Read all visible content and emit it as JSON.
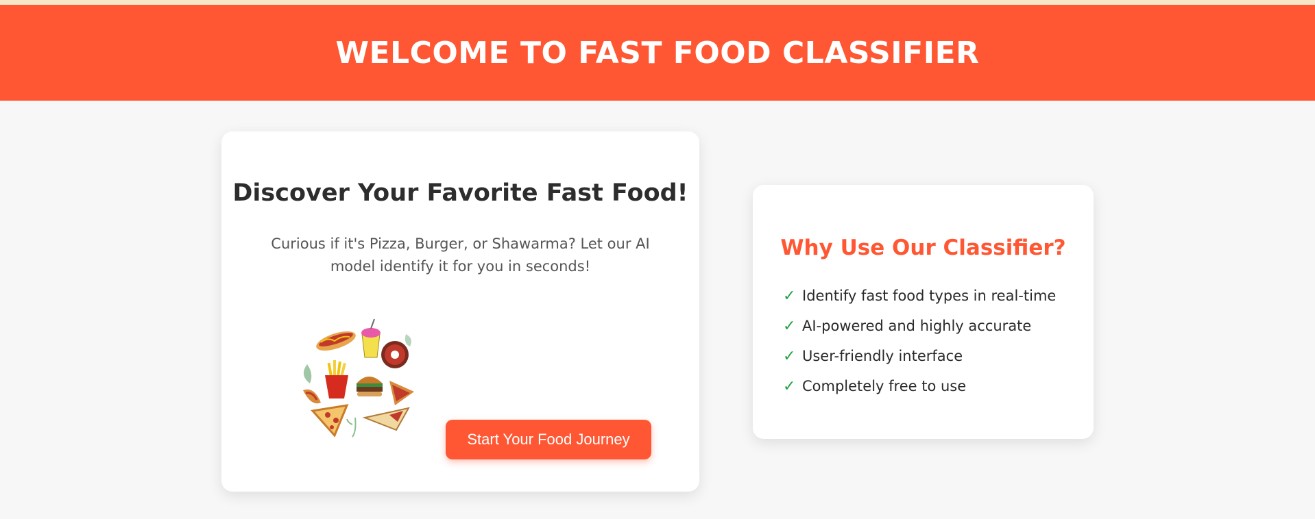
{
  "header": {
    "title": "WELCOME TO FAST FOOD CLASSIFIER"
  },
  "hero_card": {
    "title": "Discover Your Favorite Fast Food!",
    "description": "Curious if it's Pizza, Burger, or Shawarma? Let our AI model identify it for you in seconds!",
    "image": "fast-food-illustration",
    "button_label": "Start Your Food Journey"
  },
  "features_card": {
    "title": "Why Use Our Classifier?",
    "items": [
      {
        "icon": "check-icon",
        "text": "Identify fast food types in real-time"
      },
      {
        "icon": "check-icon",
        "text": "AI-powered and highly accurate"
      },
      {
        "icon": "check-icon",
        "text": "User-friendly interface"
      },
      {
        "icon": "check-icon",
        "text": "Completely free to use"
      }
    ]
  },
  "colors": {
    "accent": "#ff5733",
    "check": "#22a244",
    "background": "#f7f7f7"
  }
}
